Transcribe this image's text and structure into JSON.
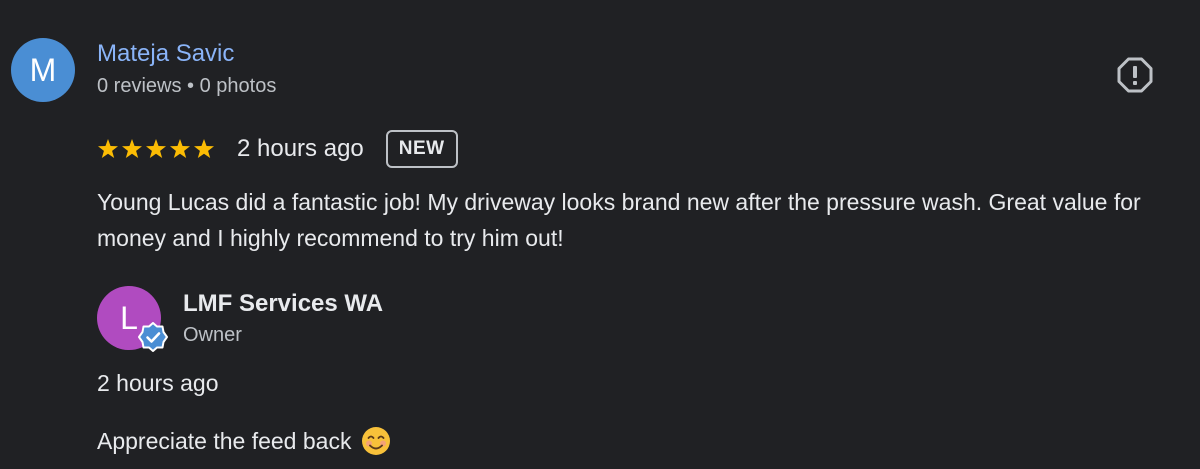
{
  "review": {
    "reviewer": {
      "initial": "M",
      "name": "Mateja Savic",
      "meta": "0 reviews • 0 photos",
      "avatar_color": "#4a8ed4"
    },
    "report_icon": "report-flag-icon",
    "rating": 5,
    "rating_max": 5,
    "star_color": "#fbbc04",
    "time": "2 hours ago",
    "badge": "NEW",
    "text": "Young Lucas did a fantastic job! My driveway looks brand new after the pressure wash. Great value for money and I highly recommend to try him out!"
  },
  "reply": {
    "owner": {
      "initial": "L",
      "name": "LMF Services WA",
      "role": "Owner",
      "avatar_color": "#b04bc0",
      "verified_icon": "verified-check-icon"
    },
    "time": "2 hours ago",
    "text": "Appreciate the feed back",
    "emoji": "smiling-face-emoji"
  },
  "colors": {
    "background": "#202124",
    "link": "#8ab4f8",
    "text": "#e8eaed",
    "muted": "#bdc1c6"
  }
}
